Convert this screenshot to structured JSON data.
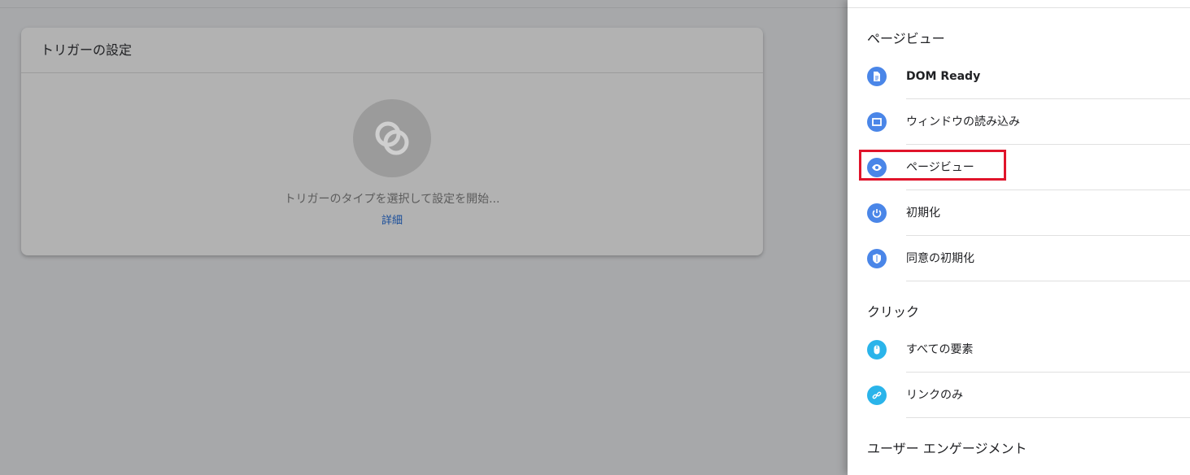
{
  "card": {
    "title": "トリガーの設定",
    "prompt": "トリガーのタイプを選択して設定を開始...",
    "link": "詳細"
  },
  "panel": {
    "sections": [
      {
        "title": "ページビュー",
        "items": [
          {
            "label": "DOM Ready",
            "icon": "document-icon",
            "bold": true
          },
          {
            "label": "ウィンドウの読み込み",
            "icon": "window-icon"
          },
          {
            "label": "ページビュー",
            "icon": "eye-icon",
            "highlighted": true
          },
          {
            "label": "初期化",
            "icon": "power-icon"
          },
          {
            "label": "同意の初期化",
            "icon": "shield-icon"
          }
        ]
      },
      {
        "title": "クリック",
        "items": [
          {
            "label": "すべての要素",
            "icon": "mouse-icon"
          },
          {
            "label": "リンクのみ",
            "icon": "link-icon"
          }
        ]
      },
      {
        "title": "ユーザー エンゲージメント",
        "items": []
      }
    ]
  },
  "colors": {
    "accent_blue": "#4a86e8",
    "accent_cyan": "#2ab4ea",
    "highlight_red": "#e0142b",
    "link": "#1a4e9a"
  }
}
